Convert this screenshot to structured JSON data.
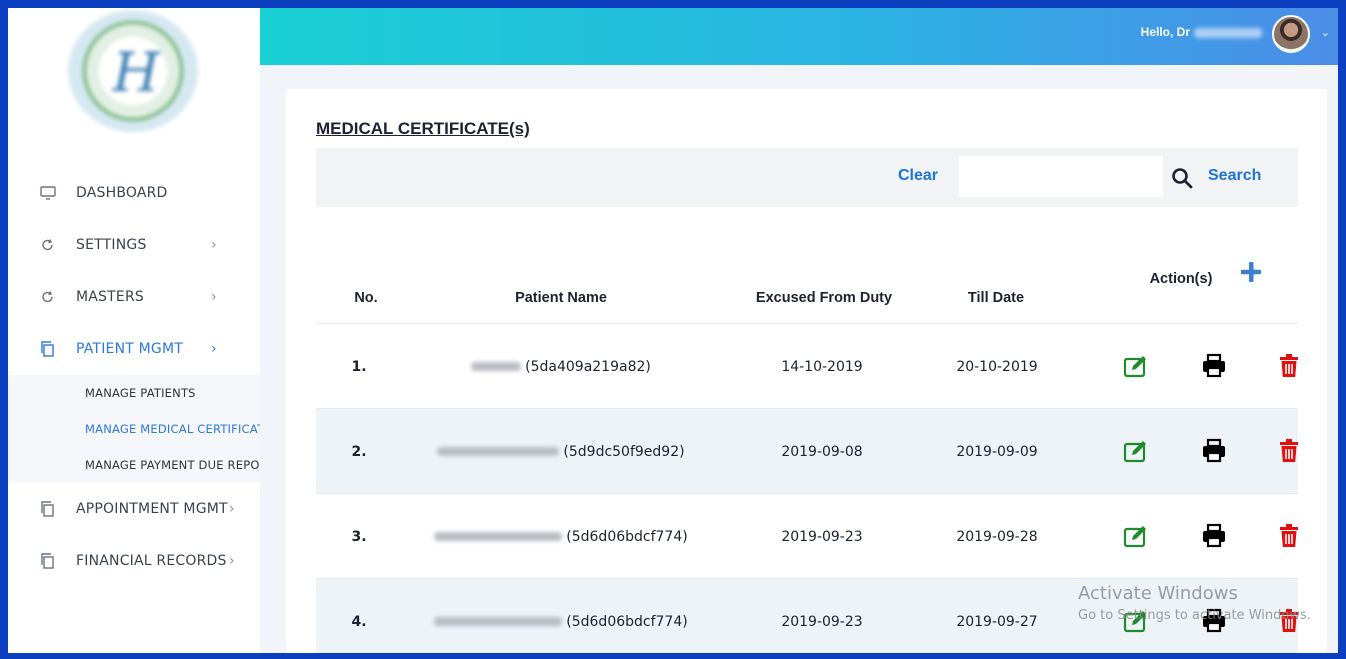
{
  "header": {
    "greeting": "Hello, Dr",
    "caret": "⌄"
  },
  "sidebar": {
    "items": [
      {
        "label": "DASHBOARD",
        "icon": "monitor-icon"
      },
      {
        "label": "SETTINGS",
        "icon": "refresh-icon",
        "chevron": "›"
      },
      {
        "label": "MASTERS",
        "icon": "refresh-icon",
        "chevron": "›"
      },
      {
        "label": "PATIENT MGMT",
        "icon": "copy-icon",
        "chevron": "›",
        "active": true
      },
      {
        "label": "APPOINTMENT MGMT",
        "icon": "copy-icon",
        "chevron": "›"
      },
      {
        "label": "FINANCIAL RECORDS",
        "icon": "copy-icon",
        "chevron": "›"
      }
    ],
    "submenu": [
      {
        "label": "MANAGE PATIENTS"
      },
      {
        "label": "MANAGE MEDICAL CERTIFICATE",
        "active": true
      },
      {
        "label": "MANAGE PAYMENT DUE REPORT"
      }
    ]
  },
  "main": {
    "title": "MEDICAL CERTIFICATE(s)",
    "search": {
      "clear_label": "Clear",
      "placeholder": "",
      "value": "",
      "search_label": "Search"
    },
    "table": {
      "headers": [
        "No.",
        "Patient Name",
        "Excused From Duty",
        "Till Date",
        "Action(s)"
      ],
      "rows": [
        {
          "no": "1.",
          "patient_id": "(5da409a219a82)",
          "from": "14-10-2019",
          "till": "20-10-2019"
        },
        {
          "no": "2.",
          "patient_id": "(5d9dc50f9ed92)",
          "from": "2019-09-08",
          "till": "2019-09-09"
        },
        {
          "no": "3.",
          "patient_id": "(5d6d06bdcf774)",
          "from": "2019-09-23",
          "till": "2019-09-28"
        },
        {
          "no": "4.",
          "patient_id": "(5d6d06bdcf774)",
          "from": "2019-09-23",
          "till": "2019-09-27"
        }
      ]
    }
  },
  "watermark": {
    "line1": "Activate Windows",
    "line2": "Go to Settings to activate Windows."
  },
  "colors": {
    "accent": "#2d78d8",
    "edit": "#1f8a2e",
    "delete": "#e01010",
    "add": "#3b7fd0"
  }
}
